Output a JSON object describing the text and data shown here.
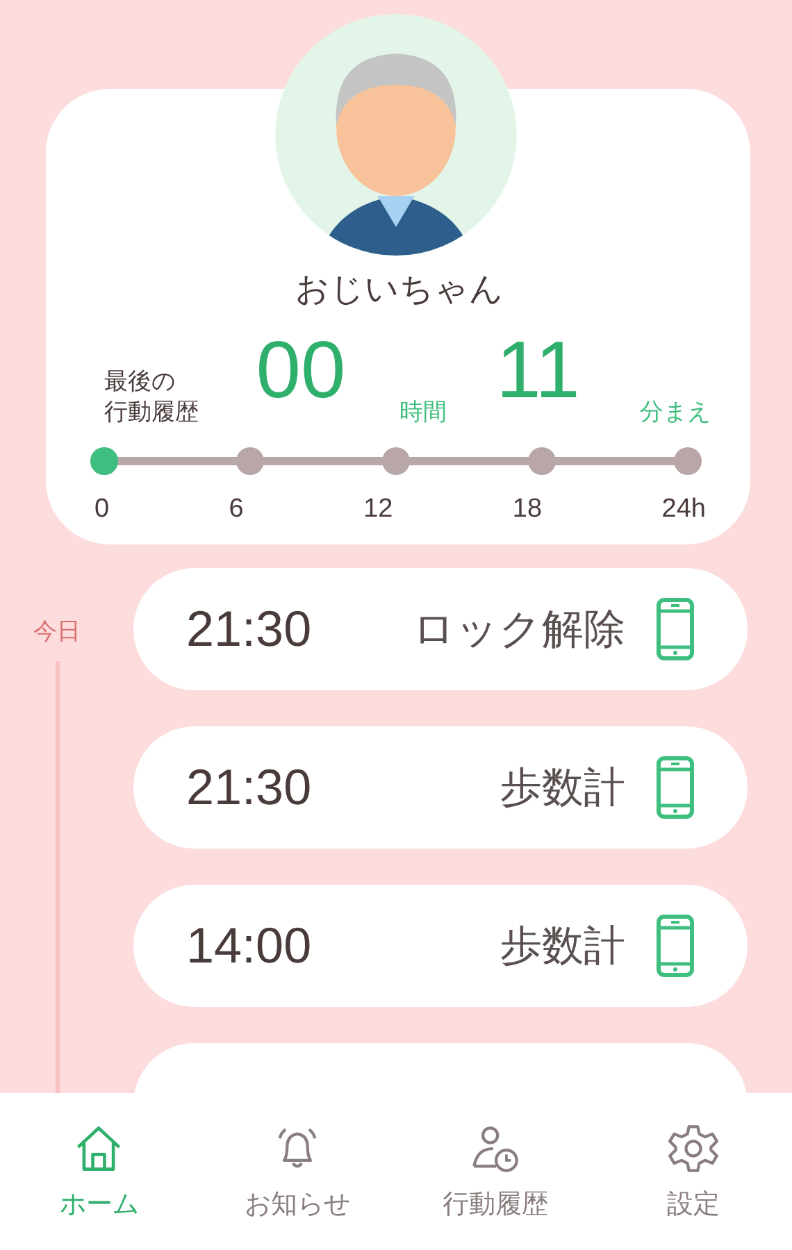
{
  "profile": {
    "name": "おじいちゃん"
  },
  "last_activity": {
    "label_line1": "最後の",
    "label_line2": "行動履歴",
    "hours": "00",
    "hours_unit": "時間",
    "minutes": "11",
    "minutes_unit": "分まえ"
  },
  "day_slider": {
    "level": 0,
    "ticks": [
      "0",
      "6",
      "12",
      "18",
      "24h"
    ]
  },
  "timeline": {
    "day_label": "今日",
    "entries": [
      {
        "time": "21:30",
        "event": "ロック解除",
        "kind": "phone"
      },
      {
        "time": "21:30",
        "event": "歩数計",
        "kind": "phone"
      },
      {
        "time": "14:00",
        "event": "歩数計",
        "kind": "phone"
      },
      {
        "kind": "cut"
      }
    ]
  },
  "bottom_nav": [
    {
      "label": "ホーム",
      "kind": "home",
      "selected": true
    },
    {
      "label": "お知らせ",
      "kind": "bell",
      "selected": false
    },
    {
      "label": "行動履歴",
      "kind": "history",
      "selected": false
    },
    {
      "label": "設定",
      "kind": "settings",
      "selected": false
    }
  ]
}
